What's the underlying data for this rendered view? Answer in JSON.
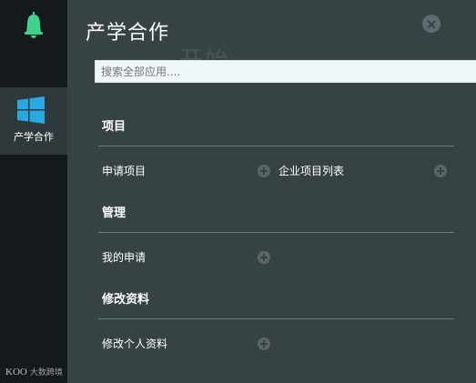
{
  "sidebar": {
    "bell_icon": "bell-icon",
    "nav_item": {
      "label": "产学合作",
      "icon": "windows-icon"
    },
    "brand": {
      "logo": "KOO",
      "text": "大数跨境"
    }
  },
  "header": {
    "title": "产学合作",
    "ghost_text": "开始",
    "close_icon": "close-icon"
  },
  "search": {
    "placeholder": "搜索全部应用...."
  },
  "sections": [
    {
      "title": "项目",
      "items": [
        "申请项目",
        "企业项目列表"
      ]
    },
    {
      "title": "管理",
      "items": [
        "我的申请"
      ]
    },
    {
      "title": "修改资料",
      "items": [
        "修改个人资料"
      ]
    }
  ],
  "colors": {
    "sidebar_bg": "#141a1c",
    "panel_bg": "#374245",
    "active_nav_bg": "#2f383b",
    "bell_green": "#3fd28a",
    "windows_blue": "#29a9e1"
  }
}
